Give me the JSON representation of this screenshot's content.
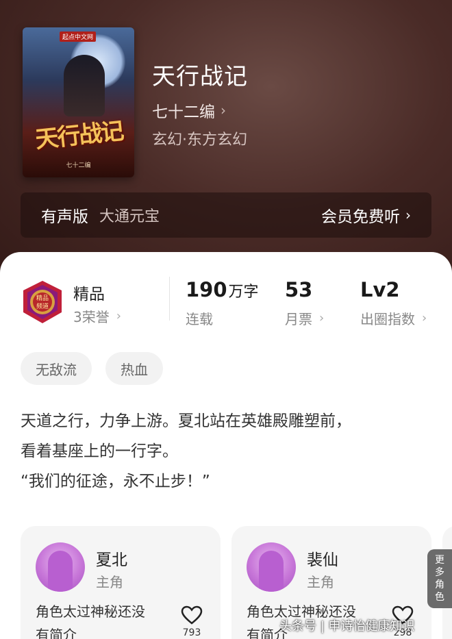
{
  "book": {
    "title": "天行战记",
    "author": "七十二编",
    "genre": "玄幻·东方玄幻",
    "cover_publisher": "起点中文网",
    "cover_title": "天行战记",
    "cover_author": "七十二编"
  },
  "audio": {
    "label": "有声版",
    "narrator": "大通元宝",
    "action": "会员免费听"
  },
  "badge": {
    "title": "精品",
    "honors": "3荣誉"
  },
  "stats": {
    "words_value": "190",
    "words_unit": "万字",
    "status": "连载",
    "tickets_value": "53",
    "tickets_label": "月票",
    "level_value": "Lv2",
    "level_label": "出圈指数"
  },
  "tags": [
    "无敌流",
    "热血"
  ],
  "synopsis": [
    "天道之行，力争上游。夏北站在英雄殿雕塑前，",
    "看着基座上的一行字。",
    "“我们的征途，永不止步！”"
  ],
  "characters": [
    {
      "name": "夏北",
      "role": "主角",
      "desc_line1": "角色太过神秘还没",
      "desc_line2": "有简介",
      "likes": "793"
    },
    {
      "name": "裴仙",
      "role": "主角",
      "desc_line1": "角色太过神秘还没",
      "desc_line2": "有简介",
      "likes": "298"
    }
  ],
  "more_characters": [
    "更",
    "多",
    "角",
    "色"
  ],
  "watermark": "头条号 | 申诗怡健康知识",
  "colors": {
    "hero_bg": "#4a2b27",
    "cover_title": "#f4c25a",
    "avatar": "#c776d8"
  }
}
